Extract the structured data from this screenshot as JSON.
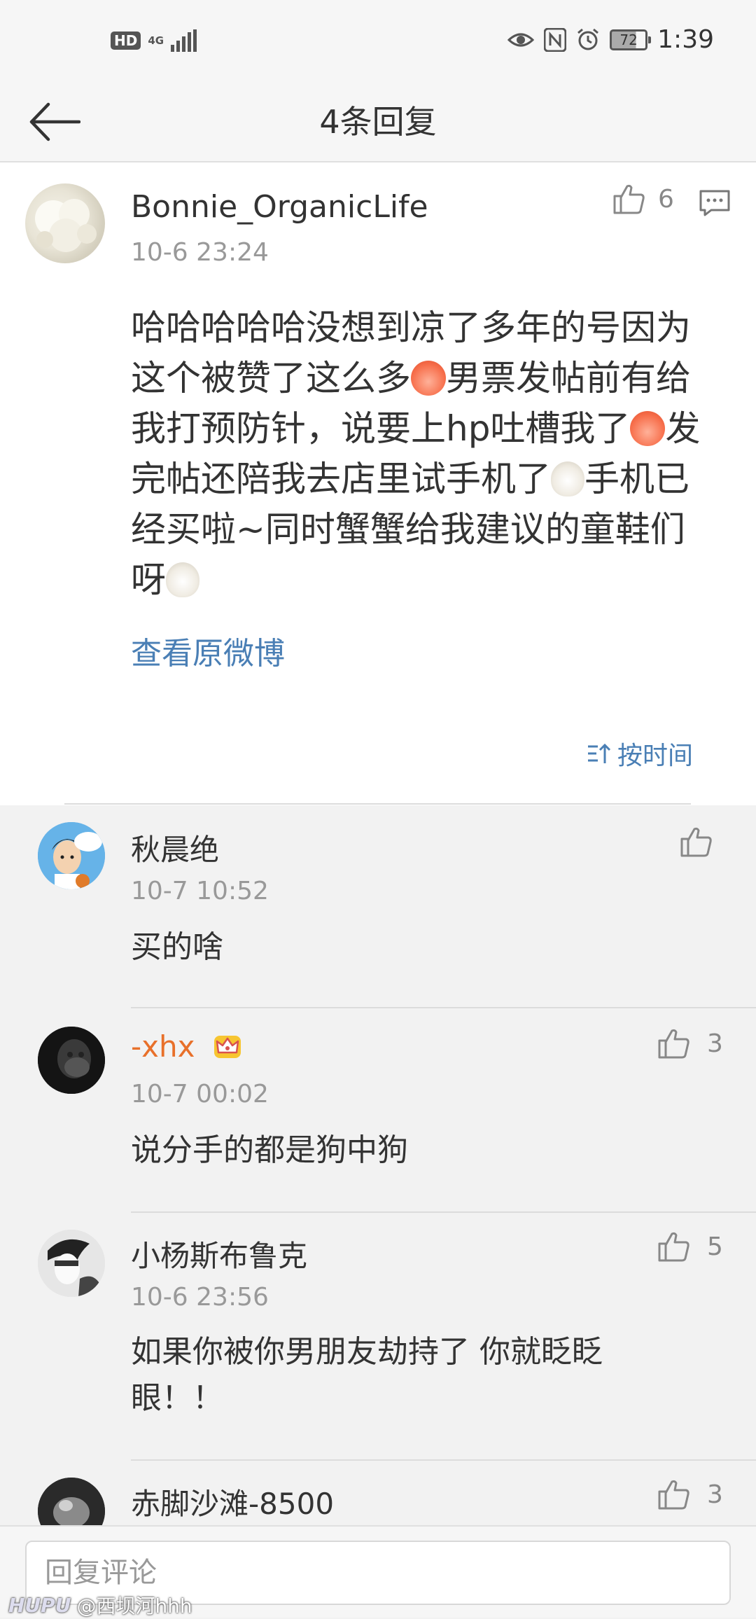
{
  "status_bar": {
    "hd": "HD",
    "network": "4G",
    "battery": "72",
    "time": "1:39"
  },
  "header": {
    "title": "4条回复"
  },
  "main_comment": {
    "author": "Bonnie_OrganicLife",
    "time": "10-6 23:24",
    "likes": "6",
    "text_parts": [
      "哈哈哈哈哈没想到凉了多年的号因为这个被赞了这么多",
      "男票发帖前有给我打预防针，说要上hp吐槽我了",
      "发完帖还陪我去店里试手机了",
      "手机已经买啦~同时蟹蟹给我建议的童鞋们呀"
    ],
    "view_original": "查看原微博",
    "sort_label": "按时间"
  },
  "replies": [
    {
      "name": "秋晨绝",
      "time": "10-7 10:52",
      "text": "买的啥",
      "likes": ""
    },
    {
      "name": "-xhx",
      "time": "10-7 00:02",
      "text": "说分手的都是狗中狗",
      "likes": "3"
    },
    {
      "name": "小杨斯布鲁克",
      "time": "10-6 23:56",
      "text": "如果你被你男朋友劫持了 你就眨眨眼！！",
      "likes": "5"
    },
    {
      "name": "赤脚沙滩-8500",
      "time": "",
      "text": "",
      "likes": "3"
    }
  ],
  "bottom": {
    "placeholder": "回复评论"
  },
  "watermark": {
    "brand": "HUPU",
    "user": "@西坝河hhh"
  },
  "colors": {
    "link": "#4a7fb5",
    "vip_name": "#e8702a",
    "background": "#f2f2f2"
  }
}
